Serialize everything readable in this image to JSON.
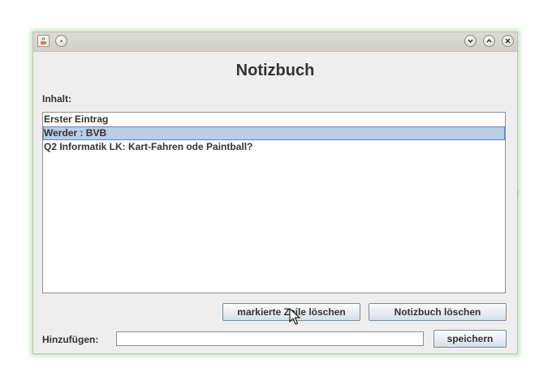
{
  "window": {
    "icons": {
      "app": "java-coffee-icon",
      "menu": "window-menu-icon",
      "minimize": "chevron-down-icon",
      "maximize": "chevron-up-icon",
      "close": "close-icon"
    }
  },
  "main": {
    "heading": "Notizbuch",
    "content_label": "Inhalt:",
    "entries": [
      "Erster Eintrag",
      "Werder : BVB",
      "Q2 Informatik LK: Kart-Fahren ode Paintball?"
    ],
    "selected_index": 1
  },
  "buttons": {
    "delete_line": "markierte Zeile löschen",
    "delete_notebook": "Notizbuch löschen",
    "save": "speichern"
  },
  "add": {
    "label": "Hinzufügen:",
    "value": ""
  },
  "colors": {
    "selection": "#b8cfe5",
    "selection_border": "#6382bf",
    "window_bg": "#eeeeee"
  }
}
